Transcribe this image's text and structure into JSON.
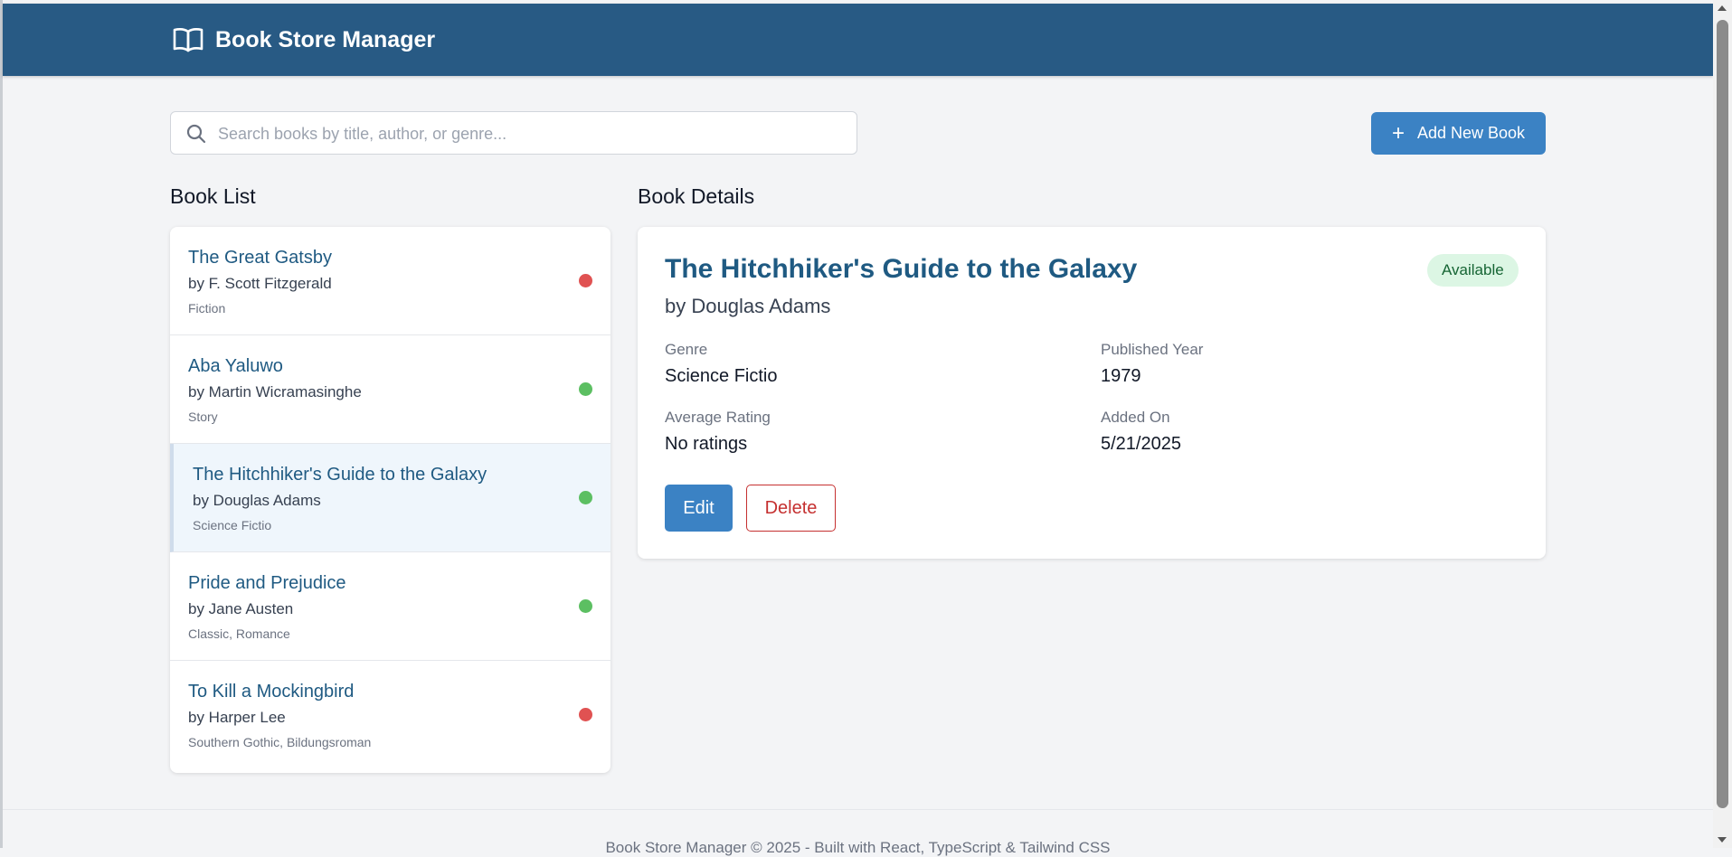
{
  "header": {
    "title": "Book Store Manager",
    "icon": "book-open-icon",
    "background": "#285a84"
  },
  "search": {
    "placeholder": "Search books by title, author, or genre...",
    "value": "",
    "icon": "search-icon"
  },
  "add_button": {
    "label": "Add New Book",
    "icon": "plus-icon",
    "color": "#3b82c4"
  },
  "book_list": {
    "title": "Book List",
    "items": [
      {
        "title": "The Great Gatsby",
        "author": "by F. Scott Fitzgerald",
        "genre": "Fiction",
        "status_color": "#e05252",
        "selected": false
      },
      {
        "title": "Aba Yaluwo",
        "author": "by Martin Wicramasinghe",
        "genre": "Story",
        "status_color": "#5cbf62",
        "selected": false
      },
      {
        "title": "The Hitchhiker's Guide to the Galaxy",
        "author": "by Douglas Adams",
        "genre": "Science Fictio",
        "status_color": "#5cbf62",
        "selected": true
      },
      {
        "title": "Pride and Prejudice",
        "author": "by Jane Austen",
        "genre": "Classic, Romance",
        "status_color": "#5cbf62",
        "selected": false
      },
      {
        "title": "To Kill a Mockingbird",
        "author": "by Harper Lee",
        "genre": "Southern Gothic, Bildungsroman",
        "status_color": "#e05252",
        "selected": false
      }
    ]
  },
  "details": {
    "section_title": "Book Details",
    "title": "The Hitchhiker's Guide to the Galaxy",
    "author": "by Douglas Adams",
    "status": "Available",
    "fields": {
      "genre_label": "Genre",
      "genre_value": "Science Fictio",
      "year_label": "Published Year",
      "year_value": "1979",
      "rating_label": "Average Rating",
      "rating_value": "No ratings",
      "added_label": "Added On",
      "added_value": "5/21/2025"
    },
    "edit_label": "Edit",
    "delete_label": "Delete"
  },
  "footer": {
    "text": "Book Store Manager © 2025 - Built with React, TypeScript & Tailwind CSS"
  }
}
